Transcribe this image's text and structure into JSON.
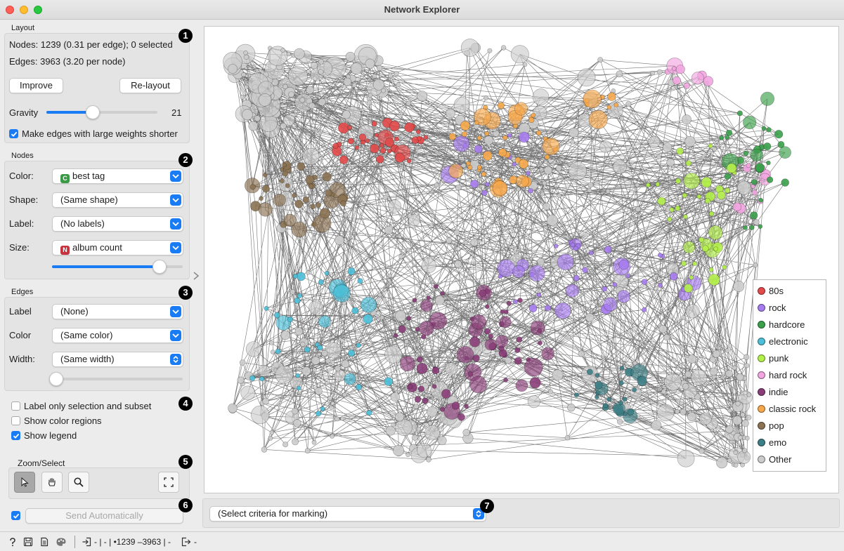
{
  "window": {
    "title": "Network Explorer"
  },
  "layout": {
    "title": "Layout",
    "nodes_info": "Nodes: 1239 (0.31 per edge); 0 selected",
    "edges_info": "Edges: 3963 (3.20 per node)",
    "improve_label": "Improve",
    "relayout_label": "Re-layout",
    "gravity_label": "Gravity",
    "gravity_value": "21",
    "gravity_fraction": 0.42,
    "weights_checkbox_label": "Make edges with large weights shorter",
    "weights_checked": true
  },
  "nodes": {
    "title": "Nodes",
    "color_label": "Color:",
    "color_value": "best tag",
    "color_type_letter": "C",
    "shape_label": "Shape:",
    "shape_value": "(Same shape)",
    "label_label": "Label:",
    "label_value": "(No labels)",
    "size_label": "Size:",
    "size_value": "album count",
    "size_type_letter": "N",
    "size_fraction": 0.82
  },
  "edges": {
    "title": "Edges",
    "label_label": "Label",
    "label_value": "(None)",
    "color_label": "Color",
    "color_value": "(Same color)",
    "width_label": "Width:",
    "width_value": "(Same width)",
    "width_fraction": 0.03
  },
  "options": {
    "label_selection": "Label only selection and subset",
    "label_selection_checked": false,
    "color_regions": "Show color regions",
    "color_regions_checked": false,
    "show_legend": "Show legend",
    "show_legend_checked": true
  },
  "zoom": {
    "title": "Zoom/Select"
  },
  "send": {
    "label": "Send Automatically",
    "checked": true
  },
  "marking": {
    "placeholder": "(Select criteria for marking)"
  },
  "badges": [
    "1",
    "2",
    "3",
    "4",
    "5",
    "6",
    "7"
  ],
  "legend": [
    {
      "name": "80s",
      "color": "#e34a4a"
    },
    {
      "name": "rock",
      "color": "#a77cf0"
    },
    {
      "name": "hardcore",
      "color": "#3aa04a"
    },
    {
      "name": "electronic",
      "color": "#4bc0d8"
    },
    {
      "name": "punk",
      "color": "#b4f04a"
    },
    {
      "name": "hard rock",
      "color": "#f2a6e0"
    },
    {
      "name": "indie",
      "color": "#8a3e78"
    },
    {
      "name": "classic rock",
      "color": "#f7a84a"
    },
    {
      "name": "pop",
      "color": "#8b7252"
    },
    {
      "name": "emo",
      "color": "#3d7f86"
    },
    {
      "name": "Other",
      "color": "#cccccc"
    }
  ],
  "status": {
    "text": "- | - | •1239 –3963 | -",
    "output": "-"
  },
  "icons": [
    "help-icon",
    "save-icon",
    "report-icon",
    "palette-icon",
    "input-icon",
    "output-icon",
    "pointer-icon",
    "hand-icon",
    "magnifier-icon",
    "fit-icon",
    "collapse-arrow-icon"
  ]
}
